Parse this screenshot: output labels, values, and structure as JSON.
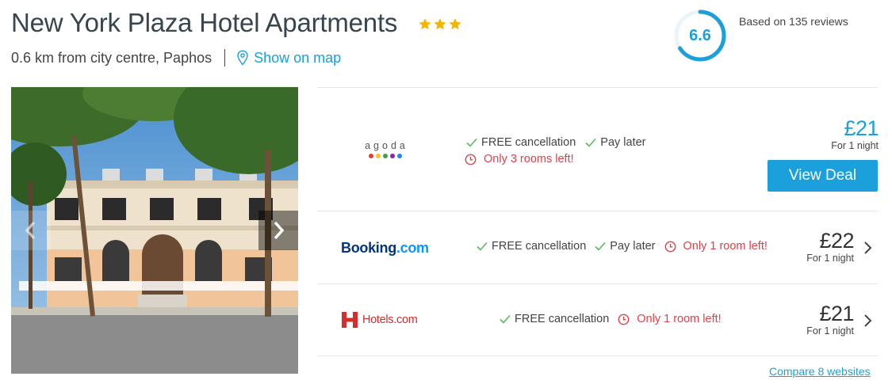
{
  "hotel": {
    "name": "New York Plaza Hotel Apartments",
    "star_count": 3,
    "location": "0.6 km from city centre, Paphos",
    "map_link": "Show on map"
  },
  "rating": {
    "score": "6.6",
    "score_fraction": 0.66,
    "reviews_text": "Based on 135 reviews"
  },
  "deals": [
    {
      "provider": "agoda",
      "features": [
        "FREE cancellation",
        "Pay later"
      ],
      "warning": "Only 3 rooms left!",
      "price": "£21",
      "per": "For 1 night",
      "button": "View Deal"
    },
    {
      "provider": "Booking.com",
      "provider_main": "Booking",
      "provider_suffix": ".com",
      "features": [
        "FREE cancellation",
        "Pay later"
      ],
      "warning": "Only 1 room left!",
      "price": "£22",
      "per": "For 1 night"
    },
    {
      "provider": "Hotels.com",
      "features": [
        "FREE cancellation"
      ],
      "warning": "Only 1 room left!",
      "price": "£21",
      "per": "For 1 night"
    }
  ],
  "compare_link": "Compare 8 websites",
  "icons": {
    "star": "star-icon",
    "map_pin": "map-pin-icon",
    "check": "check-icon",
    "clock": "clock-icon",
    "prev": "chevron-left-icon",
    "next": "chevron-right-icon"
  },
  "colors": {
    "accent": "#1ba0db",
    "warning": "#e0404a",
    "check": "#5cb85c",
    "star": "#f5b400",
    "title": "#37454d",
    "booking_blue": "#003580",
    "booking_light": "#0896ff",
    "hotels_red": "#d32f2f"
  }
}
